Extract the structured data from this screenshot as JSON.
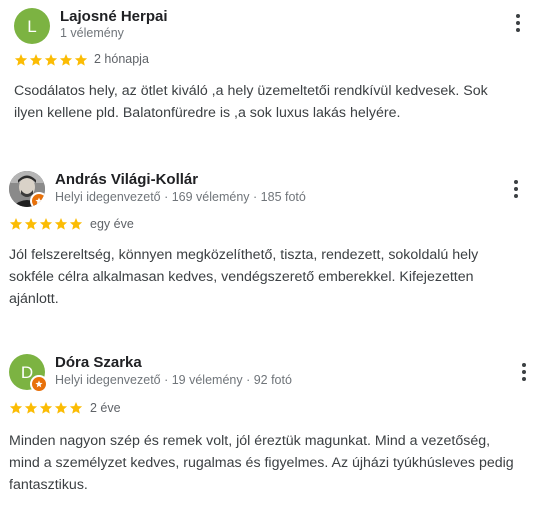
{
  "colors": {
    "star": "#fbbc04",
    "avatar_lajosne": "#7cb342",
    "avatar_dora": "#7cb342",
    "local_guide_badge": "#e8710a"
  },
  "reviews": [
    {
      "avatar_letter": "L",
      "name": "Lajosné Herpai",
      "meta": "1 vélemény",
      "rating": 5,
      "when": "2 hónapja",
      "text": "Csodálatos hely, az ötlet kiváló ,a hely üzemeltetői rendkívül kedvesek. Sok ilyen kellene pld. Balatonfüredre is ,a sok luxus lakás helyére."
    },
    {
      "avatar_icon": "profile-photo",
      "name": "András Világi-Kollár",
      "meta": "Helyi idegenvezető · 169 vélemény · 185 fotó",
      "rating": 5,
      "when": "egy éve",
      "text": "Jól felszereltség, könnyen megközelíthető, tiszta, rendezett, sokoldalú hely sokféle célra alkalmasan kedves, vendégszerető emberekkel. Kifejezetten ajánlott."
    },
    {
      "avatar_letter": "D",
      "name": "Dóra Szarka",
      "meta": "Helyi idegenvezető · 19 vélemény · 92 fotó",
      "rating": 5,
      "when": "2 éve",
      "text": "Minden nagyon szép és remek volt, jól éreztük magunkat. Mind a vezetőség, mind a személyzet kedves, rugalmas és figyelmes. Az újházi tyúkhúsleves pedig fantasztikus."
    }
  ]
}
